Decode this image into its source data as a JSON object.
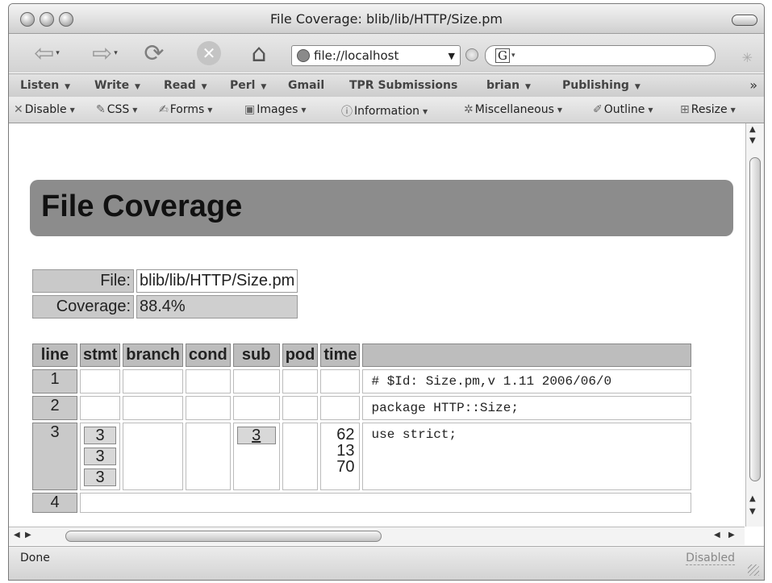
{
  "window": {
    "title": "File Coverage: blib/lib/HTTP/Size.pm"
  },
  "nav": {
    "url": "file://localhost",
    "search_engine_icon": "G"
  },
  "bookmarks": [
    {
      "label": "Listen",
      "menu": true
    },
    {
      "label": "Write",
      "menu": true
    },
    {
      "label": "Read",
      "menu": true
    },
    {
      "label": "Perl",
      "menu": true
    },
    {
      "label": "Gmail",
      "menu": false
    },
    {
      "label": "TPR Submissions",
      "menu": false
    },
    {
      "label": "brian",
      "menu": true
    },
    {
      "label": "Publishing",
      "menu": true
    }
  ],
  "devtools": [
    {
      "label": "Disable",
      "icon": "x-icon"
    },
    {
      "label": "CSS",
      "icon": "css-icon"
    },
    {
      "label": "Forms",
      "icon": "forms-icon"
    },
    {
      "label": "Images",
      "icon": "images-icon"
    },
    {
      "label": "Information",
      "icon": "information-icon"
    },
    {
      "label": "Miscellaneous",
      "icon": "miscellaneous-icon"
    },
    {
      "label": "Outline",
      "icon": "outline-icon"
    },
    {
      "label": "Resize",
      "icon": "resize-icon"
    }
  ],
  "page": {
    "heading": "File Coverage",
    "file_label": "File:",
    "file_value": "blib/lib/HTTP/Size.pm",
    "coverage_label": "Coverage:",
    "coverage_value": "88.4%"
  },
  "table": {
    "headers": [
      "line",
      "stmt",
      "branch",
      "cond",
      "sub",
      "pod",
      "time",
      ""
    ],
    "rows": [
      {
        "line": "1",
        "code": "# $Id: Size.pm,v 1.11 2006/06/0"
      },
      {
        "line": "2",
        "code": "package HTTP::Size;"
      },
      {
        "line": "3",
        "stmt": [
          "3",
          "3",
          "3"
        ],
        "sub": "3",
        "time": [
          "62",
          "13",
          "70"
        ],
        "code": "use strict;"
      },
      {
        "line": "4"
      }
    ]
  },
  "status": {
    "left": "Done",
    "right": "Disabled"
  }
}
